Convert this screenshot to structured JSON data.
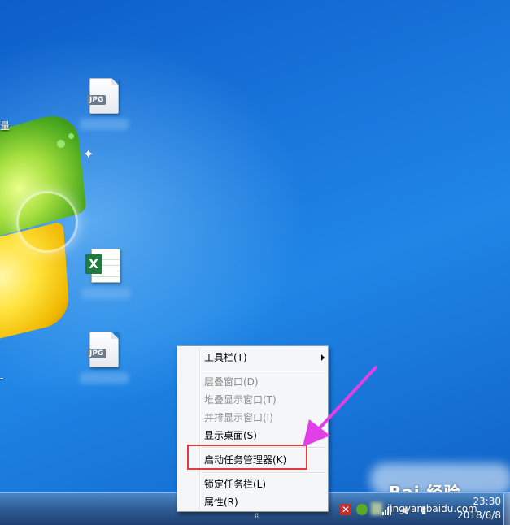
{
  "desktop": {
    "left_edge_text_1": "量",
    "left_edge_text_2": "-",
    "icons": [
      {
        "badge": "JPG",
        "type": "jpg-file"
      },
      {
        "badge": "X",
        "type": "excel-file"
      },
      {
        "badge": "JPG",
        "type": "jpg-file"
      }
    ]
  },
  "context_menu": {
    "items": [
      {
        "label": "工具栏(T)",
        "enabled": true,
        "has_submenu": true
      },
      {
        "label": "层叠窗口(D)",
        "enabled": false
      },
      {
        "label": "堆叠显示窗口(T)",
        "enabled": false
      },
      {
        "label": "并排显示窗口(I)",
        "enabled": false
      },
      {
        "label": "显示桌面(S)",
        "enabled": true
      },
      {
        "label": "启动任务管理器(K)",
        "enabled": true,
        "highlighted": true
      },
      {
        "label": "锁定任务栏(L)",
        "enabled": true
      },
      {
        "label": "属性(R)",
        "enabled": true
      }
    ]
  },
  "taskbar": {
    "time": "23:30",
    "date": "2018/6/8"
  },
  "watermark": {
    "brand": "Bai 经验",
    "url": "jingyan.baidu.com"
  },
  "colors": {
    "highlight_border": "#e03c3c",
    "pointer_arrow": "#e040e6",
    "desktop_blue": "#1a78dd"
  }
}
